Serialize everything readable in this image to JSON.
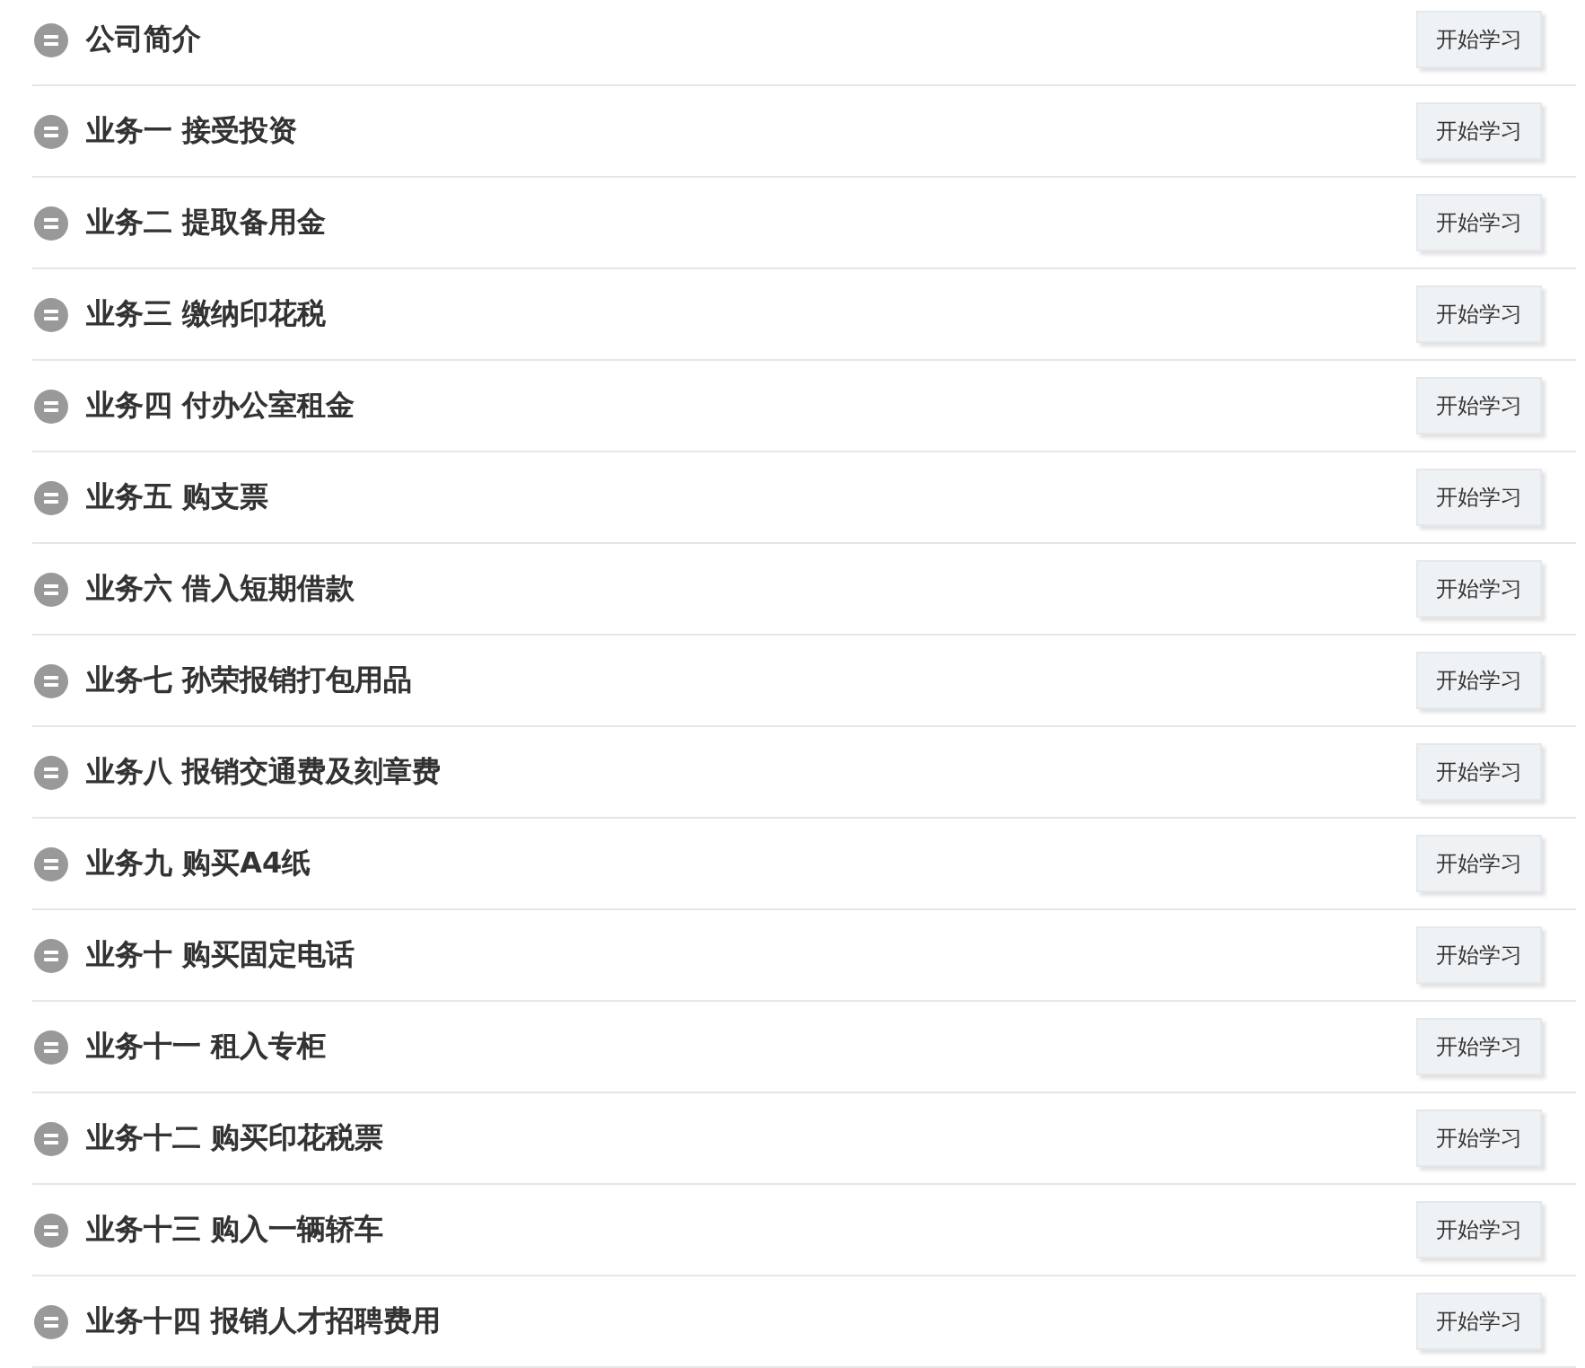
{
  "lessons": [
    {
      "title": "公司简介",
      "button": "开始学习"
    },
    {
      "title": "业务一 接受投资",
      "button": "开始学习"
    },
    {
      "title": "业务二 提取备用金",
      "button": "开始学习"
    },
    {
      "title": "业务三 缴纳印花税",
      "button": "开始学习"
    },
    {
      "title": "业务四 付办公室租金",
      "button": "开始学习"
    },
    {
      "title": "业务五 购支票",
      "button": "开始学习"
    },
    {
      "title": "业务六 借入短期借款",
      "button": "开始学习"
    },
    {
      "title": "业务七 孙荣报销打包用品",
      "button": "开始学习"
    },
    {
      "title": "业务八 报销交通费及刻章费",
      "button": "开始学习"
    },
    {
      "title": "业务九 购买A4纸",
      "button": "开始学习"
    },
    {
      "title": "业务十 购买固定电话",
      "button": "开始学习"
    },
    {
      "title": "业务十一 租入专柜",
      "button": "开始学习"
    },
    {
      "title": "业务十二 购买印花税票",
      "button": "开始学习"
    },
    {
      "title": "业务十三 购入一辆轿车",
      "button": "开始学习"
    },
    {
      "title": "业务十四 报销人才招聘费用",
      "button": "开始学习"
    }
  ]
}
